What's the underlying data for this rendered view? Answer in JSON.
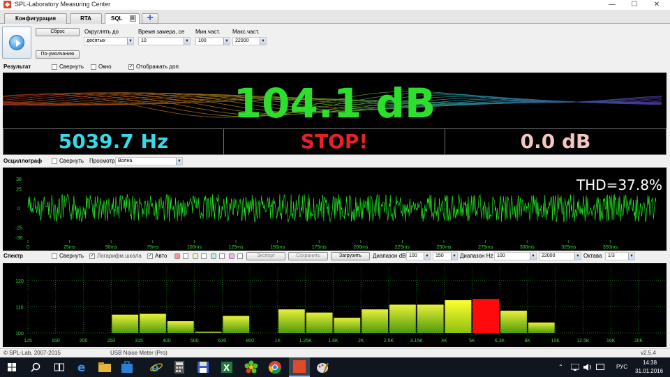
{
  "window": {
    "title": "SPL-Laboratory Measuring Center",
    "minimize": "—",
    "maximize": "☐",
    "close": "✕"
  },
  "tabs": [
    {
      "label": "Конфигурация",
      "active": false
    },
    {
      "label": "RTA",
      "active": false
    },
    {
      "label": "SQL",
      "active": true
    }
  ],
  "tab_close": "⊠",
  "tab_add": "+",
  "controls": {
    "reset_label": "Сброс",
    "default_label": "По-умолчанию",
    "round_label": "Округлять до",
    "round_value": "десятых",
    "time_label": "Время замера, се",
    "time_value": "10",
    "min_freq_label": "Мин.част.",
    "min_freq_value": "100",
    "max_freq_label": "Макс.част.",
    "max_freq_value": "22000"
  },
  "result_bar": {
    "title": "Результат",
    "collapse_label": "Свернуть",
    "collapse_checked": false,
    "window_label": "Окно",
    "window_checked": false,
    "show_extra_label": "Отображать доп.",
    "show_extra_checked": true
  },
  "result": {
    "main_value": "104.1 dB",
    "frequency": "5039.7 Hz",
    "status": "STOP!",
    "delta": "0.0 dB",
    "colors": {
      "main": "#2ddf2d",
      "frequency": "#3ad8e6",
      "status": "#e8202a",
      "delta": "#f4c7c0"
    }
  },
  "scope_bar": {
    "title": "Осциллограф",
    "collapse_label": "Свернуть",
    "collapse_checked": false,
    "view_label": "Просмотр",
    "view_value": "Волна"
  },
  "scope": {
    "thd": "THD=37.8%",
    "y_ticks": [
      "38",
      "25",
      "0",
      "-25",
      "-38"
    ],
    "x_ticks": [
      "0",
      "25ms",
      "50ms",
      "75ms",
      "100ms",
      "125ms",
      "150ms",
      "175ms",
      "200ms",
      "225ms",
      "250ms",
      "275ms",
      "300ms",
      "325ms",
      "350ms"
    ],
    "wave_color": "#22e822"
  },
  "spectrum_bar": {
    "title": "Спектр",
    "collapse_label": "Свернуть",
    "collapse_checked": false,
    "log_label": "Логарифм.шкала",
    "log_checked": true,
    "auto_label": "Авто",
    "auto_checked": true,
    "swatch_colors": [
      "#f29a9a",
      "#f5f5c8",
      "#b9ecf2",
      "#e9b6ee"
    ],
    "export_label": "Экспорт",
    "save_label": "Сохранить",
    "load_label": "Загрузить",
    "db_range_label": "Диапазон dB",
    "db_min": "100",
    "db_max": "150",
    "hz_range_label": "Диапазон Hz",
    "hz_min": "100",
    "hz_max": "22000",
    "octave_label": "Октава",
    "octave_value": "1/3"
  },
  "spectrum": {
    "y_ticks": [
      "120",
      "110",
      "100"
    ],
    "bands": [
      "125",
      "160",
      "200",
      "250",
      "315",
      "400",
      "500",
      "630",
      "800",
      "1K",
      "1.25K",
      "1.6K",
      "2K",
      "2.5K",
      "3.15K",
      "4K",
      "5K",
      "6.3K",
      "8K",
      "10K",
      "12.5K",
      "16K",
      "20K"
    ],
    "levels": [
      0,
      0,
      0,
      107,
      107.3,
      104.5,
      100.5,
      106.5,
      0,
      109,
      107.8,
      105.8,
      109,
      110.8,
      110.8,
      112.5,
      113,
      108.5,
      104,
      0,
      0,
      0,
      0
    ],
    "peak_index": 16,
    "peak_color": "#ff0a0a"
  },
  "statusbar": {
    "copyright": "© SPL-Lab, 2007-2015",
    "device": "USB Noise Meter (Pro)",
    "version": "v2.5.4"
  },
  "taskbar": {
    "lang": "РУС",
    "time": "14:38",
    "date": "31.01.2016"
  }
}
